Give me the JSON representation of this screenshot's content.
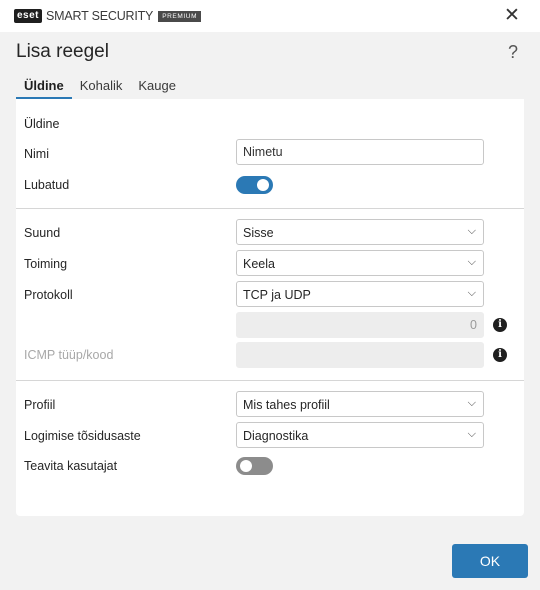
{
  "titlebar": {
    "logo_text": "eset",
    "product_name": "SMART SECURITY",
    "edition": "PREMIUM",
    "close_glyph": "✕"
  },
  "dialog": {
    "title": "Lisa reegel",
    "help_glyph": "?"
  },
  "tabs": [
    {
      "label": "Üldine",
      "active": true
    },
    {
      "label": "Kohalik",
      "active": false
    },
    {
      "label": "Kauge",
      "active": false
    }
  ],
  "form": {
    "section_header": "Üldine",
    "name": {
      "label": "Nimi",
      "value": "Nimetu"
    },
    "enabled": {
      "label": "Lubatud",
      "on": true
    },
    "direction": {
      "label": "Suund",
      "value": "Sisse"
    },
    "action": {
      "label": "Toiming",
      "value": "Keela"
    },
    "protocol": {
      "label": "Protokoll",
      "value": "TCP ja UDP"
    },
    "protocol_number": {
      "value": "0"
    },
    "icmp": {
      "label": "ICMP tüüp/kood",
      "value": ""
    },
    "profile": {
      "label": "Profiil",
      "value": "Mis tahes profiil"
    },
    "log_severity": {
      "label": "Logimise tõsidusaste",
      "value": "Diagnostika"
    },
    "notify_user": {
      "label": "Teavita kasutajat",
      "on": false
    }
  },
  "footer": {
    "ok_label": "OK"
  },
  "colors": {
    "accent": "#2b79b5",
    "toggle_off": "#8c8c8c",
    "background": "#f2f2f2",
    "panel": "#ffffff"
  },
  "icons": {
    "chevron": "chevron-down-icon",
    "info": "info-icon",
    "info_glyph": "i",
    "chevron_glyph": "⌵"
  }
}
